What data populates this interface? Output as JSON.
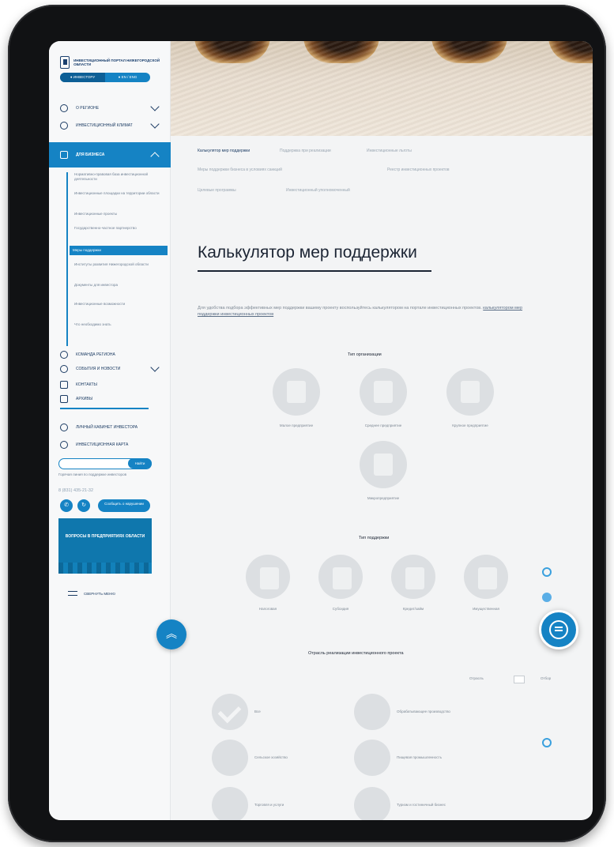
{
  "sidebar": {
    "logo_text": "ИНВЕСТИЦИОННЫЙ ПОРТАЛ НИЖЕГОРОДСКОЙ ОБЛАСТИ",
    "lang_options": [
      "● ИНВЕСТОРУ",
      "● EN / ENG"
    ],
    "nav_items": [
      {
        "label": "О РЕГИОНЕ",
        "icon": "person-icon"
      },
      {
        "label": "ИНВЕСТИЦИОННЫЙ КЛИМАТ",
        "icon": "coins-icon"
      }
    ],
    "active_section": {
      "label": "ДЛЯ БИЗНЕСА",
      "icon": "briefcase-icon"
    },
    "sub_items": [
      "Нормативно-правовая база инвестиционной деятельности",
      "Инвестиционные площадки на территории области",
      "Инвестиционные проекты",
      "Государственно-частное партнерство",
      "Меры поддержки",
      "Институты развития Нижегородской области",
      "Документы для инвестора",
      "Инвестиционные возможности",
      "Что необходимо знать"
    ],
    "active_sub_index": 4,
    "lower_items": [
      {
        "label": "КОМАНДА РЕГИОНА",
        "icon": "team-icon"
      },
      {
        "label": "СОБЫТИЯ И НОВОСТИ",
        "icon": "news-icon"
      },
      {
        "label": "КОНТАКТЫ",
        "icon": "contacts-icon"
      },
      {
        "label": "АРХИВЫ",
        "icon": "archive-icon"
      }
    ],
    "extra_items": [
      {
        "label": "ЛИЧНЫЙ КАБИНЕТ ИНВЕСТОРА",
        "icon": "user-circle-icon"
      },
      {
        "label": "ИНВЕСТИЦИОННАЯ КАРТА",
        "icon": "compass-icon"
      }
    ],
    "search_button": "Найти",
    "hotline": "Горячая линия по поддержке инвесторов",
    "phone": "8 (831) 435-21-32",
    "feedback_button": "Сообщить о нарушении",
    "promo_text": "ВОПРОСЫ В ПРЕДПРИЯТИЯХ ОБЛАСТИ",
    "close_menu": "СВЕРНУТЬ МЕНЮ"
  },
  "tabs": {
    "row1": [
      "Калькулятор мер поддержки",
      "Поддержка при реализации",
      "Инвестиционные льготы"
    ],
    "row2": [
      "Меры поддержки бизнеса в условиях санкций",
      "Реестр инвестиционных проектов"
    ],
    "row3": [
      "Целевые программы",
      "Инвестиционный уполномоченный"
    ],
    "active_index": 0
  },
  "main": {
    "title": "Калькулятор мер поддержки",
    "intro_text": "Для удобства подбора эффективных мер поддержки вашему проекту воспользуйтесь калькулятором на портале инвестиционных проектов.",
    "intro_link": "калькулятором мер поддержки инвестиционных проектов",
    "org_type_title": "Тип организации",
    "org_types": [
      "Малое предприятие",
      "Среднее предприятие",
      "Крупное предприятие",
      "Микропредприятие"
    ],
    "support_type_title": "Тип поддержки",
    "support_types": [
      "Налоговая",
      "Субсидия",
      "Кредит/займ",
      "Имущественная"
    ],
    "industry_title": "Отрасль реализации инвестиционного проекта",
    "sort_label_left": "Отрасль",
    "sort_label_right": "Отбор",
    "industries": [
      "Все",
      "Обрабатывающее производство",
      "Сельское хозяйство",
      "Пищевая промышленность",
      "Торговля и услуги",
      "Туризм и гостиничный бизнес"
    ]
  },
  "colors": {
    "accent": "#1583c4",
    "dark": "#1b2433",
    "muted": "#7d8894"
  },
  "icons": {
    "scroll_top": "double-chevron-up-icon",
    "chat": "chat-icon"
  }
}
